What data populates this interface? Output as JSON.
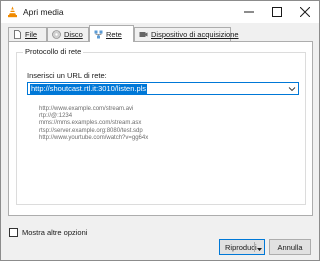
{
  "window": {
    "title": "Apri media"
  },
  "tabs": [
    {
      "label": "File",
      "mnemonic": "F",
      "icon": "file-icon"
    },
    {
      "label": "Disco",
      "mnemonic": "D",
      "icon": "disc-icon"
    },
    {
      "label": "Rete",
      "mnemonic": "R",
      "icon": "network-icon",
      "active": true
    },
    {
      "label": "Dispositivo di acquisizione",
      "mnemonic": "D",
      "icon": "capture-device-icon"
    }
  ],
  "network": {
    "group_title": "Protocollo di rete",
    "url_label": "Inserisci un URL di rete:",
    "url_value": "http://shoutcast.rtl.it:3010/listen.pls",
    "examples": [
      "http://www.example.com/stream.avi",
      "rtp://@:1234",
      "mms://mms.examples.com/stream.asx",
      "rtsp://server.example.org:8080/test.sdp",
      "http://www.yourtube.com/watch?v=gg64x"
    ]
  },
  "footer": {
    "more_options_label": "Mostra altre opzioni",
    "more_options_checked": false,
    "play_label": "Riproduci",
    "cancel_label": "Annulla"
  },
  "colors": {
    "accent": "#0078d7",
    "vlc_orange": "#f08a00"
  }
}
